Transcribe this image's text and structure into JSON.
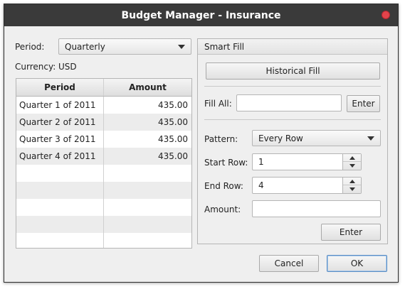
{
  "window": {
    "title": "Budget Manager - Insurance"
  },
  "period": {
    "label": "Period:",
    "value": "Quarterly"
  },
  "currency": {
    "label": "Currency:",
    "value": "USD"
  },
  "table": {
    "headers": [
      "Period",
      "Amount"
    ],
    "rows": [
      [
        "Quarter 1 of 2011",
        "435.00"
      ],
      [
        "Quarter 2 of 2011",
        "435.00"
      ],
      [
        "Quarter 3 of 2011",
        "435.00"
      ],
      [
        "Quarter 4 of 2011",
        "435.00"
      ]
    ]
  },
  "smart_fill": {
    "title": "Smart Fill",
    "historical_fill": "Historical Fill",
    "fill_all_label": "Fill All:",
    "fill_all_value": "",
    "fill_all_enter": "Enter",
    "pattern_label": "Pattern:",
    "pattern_value": "Every Row",
    "start_row_label": "Start Row:",
    "start_row_value": "1",
    "end_row_label": "End Row:",
    "end_row_value": "4",
    "amount_label": "Amount:",
    "amount_value": "",
    "enter": "Enter"
  },
  "buttons": {
    "cancel": "Cancel",
    "ok": "OK"
  },
  "colors": {
    "titlebar": "#3a3a3a",
    "close": "#e2434b",
    "default_border": "#5b8ec4"
  }
}
